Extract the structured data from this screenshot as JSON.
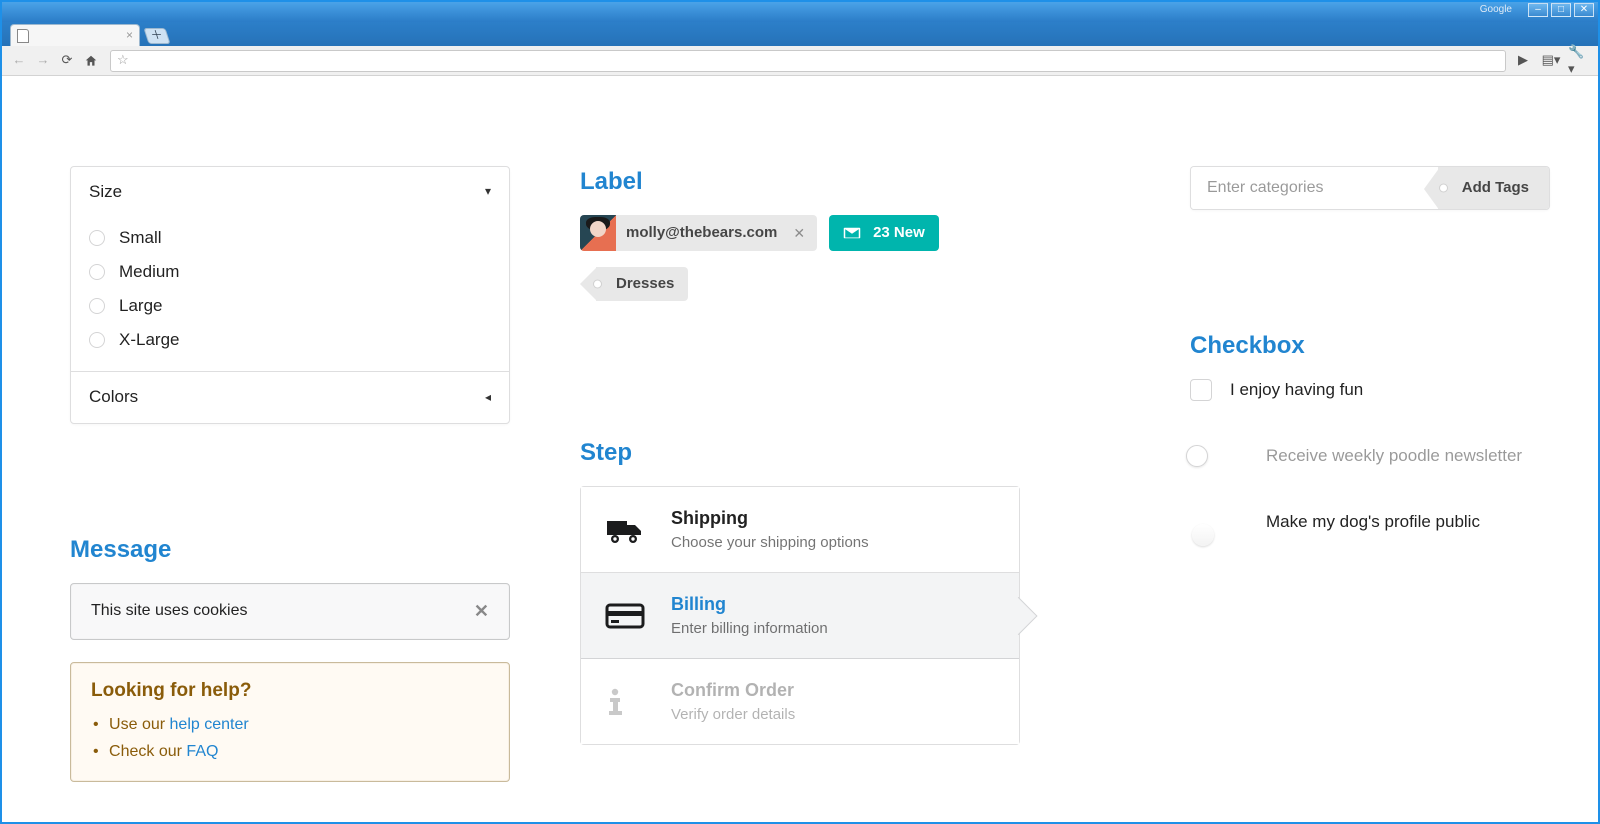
{
  "browser": {
    "brand": "Google",
    "tab_title": ""
  },
  "accordion": {
    "size_title": "Size",
    "colors_title": "Colors",
    "options": [
      "Small",
      "Medium",
      "Large",
      "X-Large"
    ]
  },
  "message": {
    "heading": "Message",
    "cookies_text": "This site uses cookies",
    "help_title": "Looking for help?",
    "help_item1_prefix": "Use our ",
    "help_item1_link": "help center",
    "help_item2_prefix": "Check our ",
    "help_item2_link": "FAQ"
  },
  "label_section": {
    "heading": "Label",
    "email_label": "molly@thebears.com",
    "new_count_label": "23 New",
    "tag_label": "Dresses"
  },
  "step_section": {
    "heading": "Step",
    "steps": [
      {
        "title": "Shipping",
        "desc": "Choose your shipping options"
      },
      {
        "title": "Billing",
        "desc": "Enter billing information"
      },
      {
        "title": "Confirm Order",
        "desc": "Verify order details"
      }
    ]
  },
  "tags_input": {
    "placeholder": "Enter categories",
    "button_label": "Add Tags"
  },
  "checkbox_section": {
    "heading": "Checkbox",
    "opt1": "I enjoy having fun",
    "opt2": "Receive weekly poodle newsletter",
    "opt3": "Make my dog's profile public"
  }
}
